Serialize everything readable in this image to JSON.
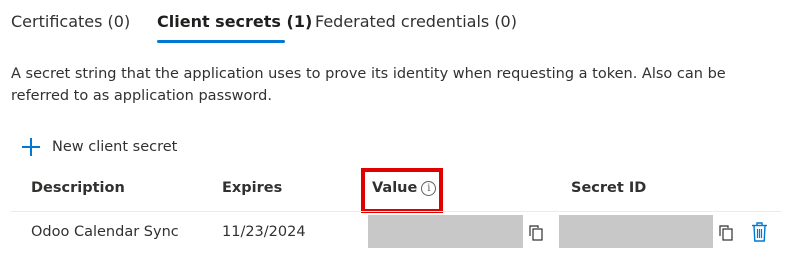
{
  "tabs": [
    {
      "label": "Certificates (0)",
      "active": false
    },
    {
      "label": "Client secrets (1)",
      "active": true
    },
    {
      "label": "Federated credentials (0)",
      "active": false
    }
  ],
  "description": "A secret string that the application uses to prove its identity when requesting a token. Also can be referred to as application password.",
  "toolbar": {
    "new_secret_label": "New client secret"
  },
  "table": {
    "columns": {
      "description": "Description",
      "expires": "Expires",
      "value": "Value",
      "secret_id": "Secret ID"
    },
    "value_info_glyph": "i",
    "rows": [
      {
        "description": "Odoo Calendar Sync",
        "expires": "11/23/2024",
        "value": "",
        "secret_id": ""
      }
    ]
  },
  "colors": {
    "accent": "#0078d4",
    "highlight_box": "#e00000",
    "masked_fill": "#c8c8c8"
  },
  "icons": {
    "add": "plus-icon",
    "info": "info-icon",
    "copy": "copy-icon",
    "delete": "trash-icon"
  }
}
